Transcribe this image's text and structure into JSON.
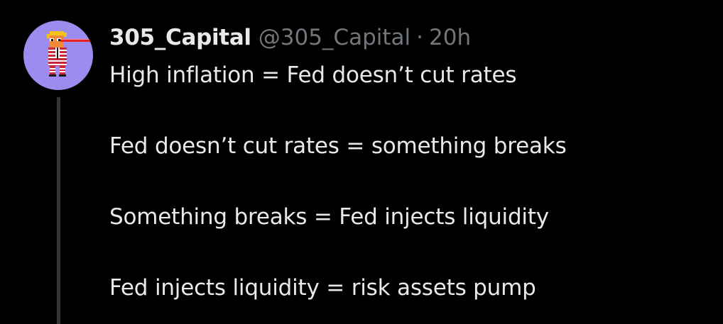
{
  "tweet": {
    "author": {
      "display_name": "305_Capital",
      "handle": "@305_Capital",
      "avatar_icon": "pixel-art-avatar-icon",
      "avatar_bg": "#9c8cf0"
    },
    "separator": "·",
    "timestamp": "20h",
    "lines": [
      "High inflation = Fed doesn’t cut rates",
      "Fed doesn’t cut rates = something breaks",
      "Something breaks = Fed injects liquidity",
      "Fed injects liquidity = risk assets pump"
    ]
  },
  "colors": {
    "background": "#000000",
    "text_primary": "#e7e9ea",
    "text_secondary": "#71767b",
    "thread_line": "#333639"
  }
}
